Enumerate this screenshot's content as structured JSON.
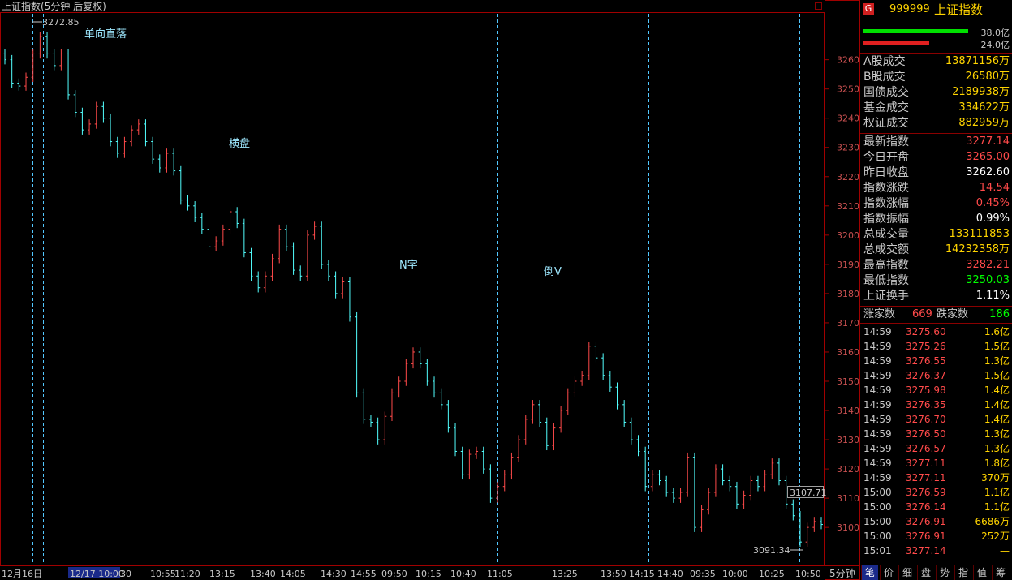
{
  "window_title": "上证指数(5分钟 后复权)",
  "timeframe_button": "5分钟",
  "colors": {
    "up": "#ff4a4a",
    "down": "#52ffff",
    "frame": "#a00000",
    "yellow": "#ffd400",
    "green": "#00ff00",
    "red": "#ff3030"
  },
  "chart_data": {
    "type": "candlestick",
    "title": "上证指数(5分钟 后复权)",
    "ylim": [
      3087,
      3276
    ],
    "yticks": [
      3100,
      3110,
      3120,
      3130,
      3140,
      3150,
      3160,
      3170,
      3180,
      3190,
      3200,
      3210,
      3220,
      3230,
      3240,
      3250,
      3260
    ],
    "xtick_labels": [
      "12月16日",
      "12/17 10:00",
      "30",
      "10:55",
      "11:20",
      "13:15",
      "13:40",
      "14:05",
      "14:30",
      "14:55",
      "09:50",
      "10:15",
      "10:40",
      "11:05",
      "13:25",
      "13:50",
      "14:15",
      "14:40",
      "09:35",
      "10:00",
      "10:25",
      "10:50"
    ],
    "annotations": [
      "单向直落",
      "横盘",
      "N字",
      "倒V"
    ],
    "high_label": "3272.85",
    "low_label": "3091.34",
    "last_price_label": "3107.71",
    "closes": [
      3260,
      3252,
      3251,
      3254,
      3262,
      3268,
      3262,
      3258,
      3262,
      3248,
      3242,
      3236,
      3238,
      3244,
      3240,
      3232,
      3228,
      3232,
      3236,
      3238,
      3232,
      3226,
      3223,
      3228,
      3222,
      3212,
      3210,
      3206,
      3202,
      3196,
      3198,
      3202,
      3208,
      3204,
      3194,
      3186,
      3182,
      3186,
      3192,
      3202,
      3196,
      3188,
      3186,
      3200,
      3203,
      3190,
      3186,
      3180,
      3184,
      3172,
      3146,
      3137,
      3136,
      3130,
      3138,
      3146,
      3150,
      3156,
      3160,
      3156,
      3150,
      3146,
      3142,
      3134,
      3126,
      3118,
      3125,
      3126,
      3120,
      3110,
      3114,
      3118,
      3124,
      3130,
      3137,
      3142,
      3136,
      3128,
      3134,
      3140,
      3146,
      3150,
      3152,
      3162,
      3158,
      3152,
      3148,
      3142,
      3136,
      3130,
      3126,
      3114,
      3118,
      3116,
      3112,
      3110,
      3112,
      3124,
      3100,
      3106,
      3112,
      3120,
      3116,
      3114,
      3108,
      3111,
      3116,
      3114,
      3118,
      3122,
      3116,
      3108,
      3104,
      3095,
      3100,
      3102,
      3101
    ]
  },
  "ticker": {
    "logo": "G",
    "code": "999999",
    "name": "上证指数"
  },
  "bars": {
    "top_value": "38.0亿",
    "bottom_value": "24.0亿",
    "top_fraction": 0.86,
    "bottom_fraction": 0.54
  },
  "volumes": [
    {
      "label": "A股成交",
      "value": "13871156万"
    },
    {
      "label": "B股成交",
      "value": "26580万"
    },
    {
      "label": "国债成交",
      "value": "2189938万"
    },
    {
      "label": "基金成交",
      "value": "334622万"
    },
    {
      "label": "权证成交",
      "value": "882959万"
    }
  ],
  "stats": [
    {
      "label": "最新指数",
      "value": "3277.14",
      "tone": "red"
    },
    {
      "label": "今日开盘",
      "value": "3265.00",
      "tone": "red"
    },
    {
      "label": "昨日收盘",
      "value": "3262.60",
      "tone": "white"
    },
    {
      "label": "指数涨跌",
      "value": "14.54",
      "tone": "red"
    },
    {
      "label": "指数涨幅",
      "value": "0.45%",
      "tone": "red"
    },
    {
      "label": "指数振幅",
      "value": "0.99%",
      "tone": "white"
    },
    {
      "label": "总成交量",
      "value": "133111853",
      "tone": "yellow"
    },
    {
      "label": "总成交额",
      "value": "14232358万",
      "tone": "yellow"
    },
    {
      "label": "最高指数",
      "value": "3282.21",
      "tone": "red"
    },
    {
      "label": "最低指数",
      "value": "3250.03",
      "tone": "green"
    },
    {
      "label": "上证换手",
      "value": "1.11%",
      "tone": "white"
    }
  ],
  "breadth": {
    "up_label": "涨家数",
    "up_value": "669",
    "down_label": "跌家数",
    "down_value": "186"
  },
  "ticks": [
    {
      "time": "14:59",
      "price": "3275.60",
      "vol": "1.6亿"
    },
    {
      "time": "14:59",
      "price": "3275.26",
      "vol": "1.5亿"
    },
    {
      "time": "14:59",
      "price": "3276.55",
      "vol": "1.3亿"
    },
    {
      "time": "14:59",
      "price": "3276.37",
      "vol": "1.5亿"
    },
    {
      "time": "14:59",
      "price": "3275.98",
      "vol": "1.4亿"
    },
    {
      "time": "14:59",
      "price": "3276.35",
      "vol": "1.4亿"
    },
    {
      "time": "14:59",
      "price": "3276.70",
      "vol": "1.4亿"
    },
    {
      "time": "14:59",
      "price": "3276.50",
      "vol": "1.3亿"
    },
    {
      "time": "14:59",
      "price": "3276.57",
      "vol": "1.3亿"
    },
    {
      "time": "14:59",
      "price": "3277.11",
      "vol": "1.8亿"
    },
    {
      "time": "14:59",
      "price": "3277.11",
      "vol": "370万"
    },
    {
      "time": "15:00",
      "price": "3276.59",
      "vol": "1.1亿"
    },
    {
      "time": "15:00",
      "price": "3276.14",
      "vol": "1.1亿"
    },
    {
      "time": "15:00",
      "price": "3276.91",
      "vol": "6686万"
    },
    {
      "time": "15:00",
      "price": "3276.91",
      "vol": "252万"
    },
    {
      "time": "15:01",
      "price": "3277.14",
      "vol": "—"
    }
  ],
  "bottom_tabs": [
    "笔",
    "价",
    "细",
    "盘",
    "势",
    "指",
    "值",
    "筹"
  ]
}
